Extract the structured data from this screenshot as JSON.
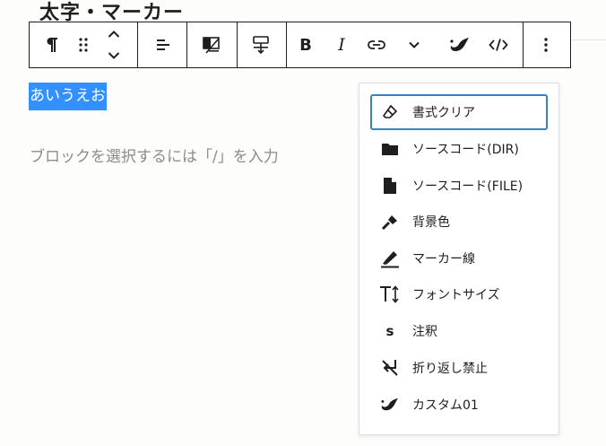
{
  "page": {
    "heading": "太字・マーカー",
    "selected_text": "あいうえお",
    "placeholder": "ブロックを選択するには「/」を入力"
  },
  "toolbar": {
    "paragraph_icon": "pilcrow-icon",
    "drag_icon": "drag-handle-icon",
    "move_up_icon": "chevron-up-icon",
    "move_down_icon": "chevron-down-icon",
    "align_icon": "align-left-icon",
    "layout_icon": "no-image-icon",
    "vertical_align_icon": "vertical-align-icon",
    "bold_label": "B",
    "italic_label": "I",
    "link_icon": "link-icon",
    "more_icon": "chevron-down-icon",
    "custom_icon": "blob-icon",
    "code_icon": "code-icon",
    "options_icon": "more-vertical-icon"
  },
  "menu": {
    "items": [
      {
        "label": "書式クリア",
        "icon": "eraser-icon"
      },
      {
        "label": "ソースコード(DIR)",
        "icon": "folder-icon"
      },
      {
        "label": "ソースコード(FILE)",
        "icon": "file-icon"
      },
      {
        "label": "背景色",
        "icon": "paint-brush-icon"
      },
      {
        "label": "マーカー線",
        "icon": "highlighter-icon"
      },
      {
        "label": "フォントサイズ",
        "icon": "font-size-icon"
      },
      {
        "label": "注釈",
        "icon": "annotation-icon"
      },
      {
        "label": "折り返し禁止",
        "icon": "no-wrap-icon"
      },
      {
        "label": "カスタム01",
        "icon": "blob-icon"
      }
    ],
    "annotation_glyph": "s"
  },
  "colors": {
    "selection": "#3390ff",
    "focus_ring": "#3582c4",
    "border": "#1e1e1e",
    "placeholder": "#8c8c8c"
  }
}
